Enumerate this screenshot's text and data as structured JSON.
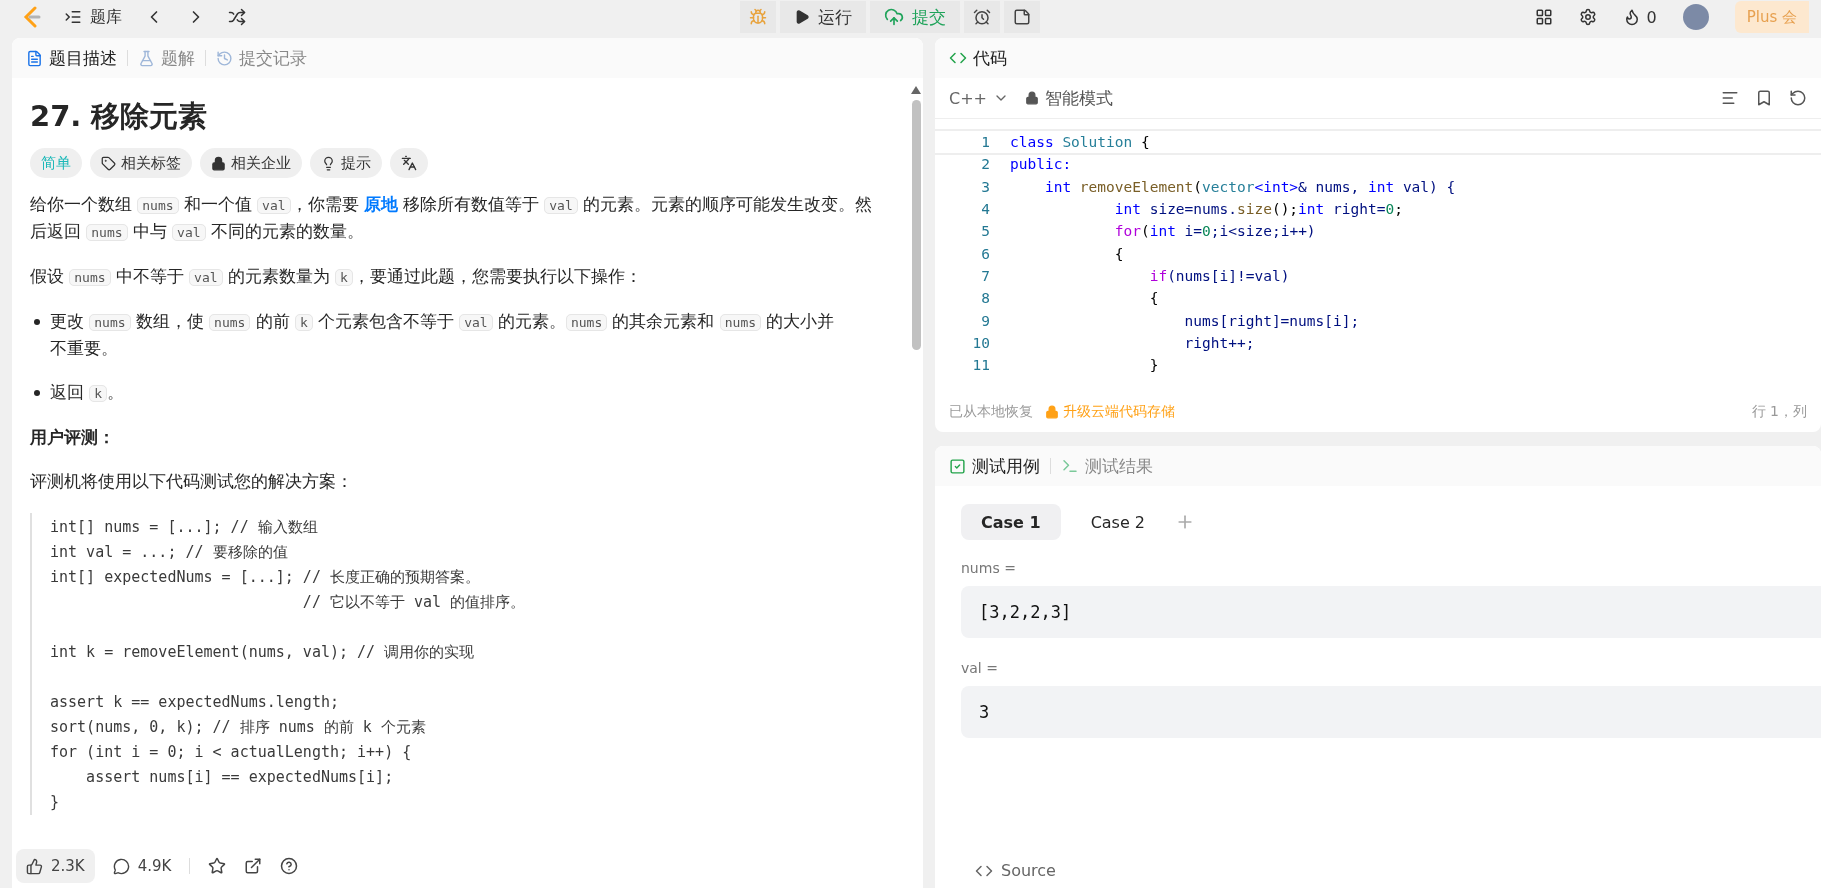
{
  "topbar": {
    "nav_label": "题库",
    "run_label": "运行",
    "submit_label": "提交",
    "coins": "0",
    "plus_label": "Plus 会"
  },
  "left": {
    "tabs": [
      {
        "label": "题目描述",
        "selected": true
      },
      {
        "label": "题解",
        "selected": false
      },
      {
        "label": "提交记录",
        "selected": false
      }
    ],
    "title": "27. 移除元素",
    "tags": [
      {
        "label": "简单",
        "kind": "difficulty"
      },
      {
        "label": "相关标签",
        "kind": "tag"
      },
      {
        "label": "相关企业",
        "kind": "lock"
      },
      {
        "label": "提示",
        "kind": "hint"
      },
      {
        "kind": "translate"
      }
    ],
    "paragraphs": [
      [
        {
          "text": "给你一个数组 ",
          "kind": "plain"
        },
        {
          "text": "nums",
          "kind": "code"
        },
        {
          "text": " 和一个值 ",
          "kind": "plain"
        },
        {
          "text": "val",
          "kind": "code"
        },
        {
          "text": "，你需要 ",
          "kind": "plain"
        },
        {
          "text": "原地",
          "kind": "link"
        },
        {
          "text": " 移除所有数值等于 ",
          "kind": "plain"
        },
        {
          "text": "val",
          "kind": "code"
        },
        {
          "text": " 的元素。元素的顺序可能发生改变。然后返回 ",
          "kind": "plain"
        },
        {
          "text": "nums",
          "kind": "code"
        },
        {
          "text": " 中与 ",
          "kind": "plain"
        },
        {
          "text": "val",
          "kind": "code"
        },
        {
          "text": " 不同的元素的数量。",
          "kind": "plain"
        }
      ],
      [
        {
          "text": "假设 ",
          "kind": "plain"
        },
        {
          "text": "nums",
          "kind": "code"
        },
        {
          "text": " 中不等于 ",
          "kind": "plain"
        },
        {
          "text": "val",
          "kind": "code"
        },
        {
          "text": " 的元素数量为 ",
          "kind": "plain"
        },
        {
          "text": "k",
          "kind": "code"
        },
        {
          "text": "，要通过此题，您需要执行以下操作：",
          "kind": "plain"
        }
      ]
    ],
    "bullets": [
      [
        {
          "text": "更改 ",
          "kind": "plain"
        },
        {
          "text": "nums",
          "kind": "code"
        },
        {
          "text": " 数组，使 ",
          "kind": "plain"
        },
        {
          "text": "nums",
          "kind": "code"
        },
        {
          "text": " 的前 ",
          "kind": "plain"
        },
        {
          "text": "k",
          "kind": "code"
        },
        {
          "text": " 个元素包含不等于 ",
          "kind": "plain"
        },
        {
          "text": "val",
          "kind": "code"
        },
        {
          "text": " 的元素。",
          "kind": "plain"
        },
        {
          "text": "nums",
          "kind": "code"
        },
        {
          "text": " 的其余元素和 ",
          "kind": "plain"
        },
        {
          "text": "nums",
          "kind": "code"
        },
        {
          "text": " 的大小并不重要。",
          "kind": "plain"
        }
      ],
      [
        {
          "text": "返回 ",
          "kind": "plain"
        },
        {
          "text": "k",
          "kind": "code"
        },
        {
          "text": "。",
          "kind": "plain"
        }
      ]
    ],
    "judge_heading": "用户评测：",
    "judge_text": "评测机将使用以下代码测试您的解决方案：",
    "judge_code": [
      [
        "int[] nums = [...]; // 输入数组",
        "int val = ...; // 要移除的值",
        "int[] expectedNums = [...]; // 长度正确的预期答案。",
        "                            // 它以不等于 val 的值排序。"
      ],
      [
        "int k = removeElement(nums, val); // 调用你的实现"
      ],
      [
        "assert k == expectedNums.length;",
        "sort(nums, 0, k); // 排序 nums 的前 k 个元素",
        "for (int i = 0; i < actualLength; i++) {",
        "    assert nums[i] == expectedNums[i];",
        "}"
      ]
    ],
    "likes": "2.3K",
    "comments": "4.9K"
  },
  "code_panel": {
    "title": "代码",
    "language": "C++",
    "mode": "智能模式",
    "lines": [
      {
        "n": "1",
        "tokens": [
          {
            "text": "class",
            "kind": "kw"
          },
          {
            "text": " Solution",
            "kind": "type"
          },
          {
            "text": " {",
            "kind": "plain"
          }
        ]
      },
      {
        "n": "2",
        "tokens": [
          {
            "text": "public:",
            "kind": "kw"
          }
        ]
      },
      {
        "n": "3",
        "tokens": [
          {
            "text": "    int",
            "kind": "kw"
          },
          {
            "text": " removeElement",
            "kind": "fn"
          },
          {
            "text": "(",
            "kind": "plain"
          },
          {
            "text": "vector",
            "kind": "type"
          },
          {
            "text": "<int>",
            "kind": "kw"
          },
          {
            "text": "& nums, ",
            "kind": "var"
          },
          {
            "text": "int",
            "kind": "kw"
          },
          {
            "text": " val) {",
            "kind": "var"
          }
        ]
      },
      {
        "n": "4",
        "tokens": [
          {
            "text": "            int",
            "kind": "kw"
          },
          {
            "text": " size=nums.",
            "kind": "var"
          },
          {
            "text": "size",
            "kind": "fn"
          },
          {
            "text": "();",
            "kind": "plain"
          },
          {
            "text": "int",
            "kind": "kw"
          },
          {
            "text": " right=",
            "kind": "var"
          },
          {
            "text": "0",
            "kind": "num"
          },
          {
            "text": ";",
            "kind": "plain"
          }
        ]
      },
      {
        "n": "5",
        "tokens": [
          {
            "text": "            for",
            "kind": "ctrl"
          },
          {
            "text": "(",
            "kind": "plain"
          },
          {
            "text": "int",
            "kind": "kw"
          },
          {
            "text": " i=",
            "kind": "var"
          },
          {
            "text": "0",
            "kind": "num"
          },
          {
            "text": ";i<size;i++)",
            "kind": "var"
          }
        ]
      },
      {
        "n": "6",
        "tokens": [
          {
            "text": "            {",
            "kind": "plain"
          }
        ]
      },
      {
        "n": "7",
        "tokens": [
          {
            "text": "                if",
            "kind": "ctrl"
          },
          {
            "text": "(nums[i]!=val)",
            "kind": "var"
          }
        ]
      },
      {
        "n": "8",
        "tokens": [
          {
            "text": "                {",
            "kind": "plain"
          }
        ]
      },
      {
        "n": "9",
        "tokens": [
          {
            "text": "                    nums[right]=nums[i];",
            "kind": "var"
          }
        ]
      },
      {
        "n": "10",
        "tokens": [
          {
            "text": "                    right++;",
            "kind": "var"
          }
        ]
      },
      {
        "n": "11",
        "tokens": [
          {
            "text": "                }",
            "kind": "plain"
          }
        ]
      }
    ],
    "restore_note": "已从本地恢复",
    "upgrade_link": "升级云端代码存储",
    "cursor": "行 1，列"
  },
  "test_panel": {
    "tabs": [
      {
        "label": "测试用例",
        "selected": true
      },
      {
        "label": "测试结果",
        "selected": false
      }
    ],
    "cases": [
      {
        "label": "Case 1",
        "selected": true
      },
      {
        "label": "Case 2",
        "selected": false
      }
    ],
    "inputs": [
      {
        "label": "nums =",
        "value": "[3,2,2,3]"
      },
      {
        "label": "val =",
        "value": "3"
      }
    ],
    "source_label": "Source"
  }
}
